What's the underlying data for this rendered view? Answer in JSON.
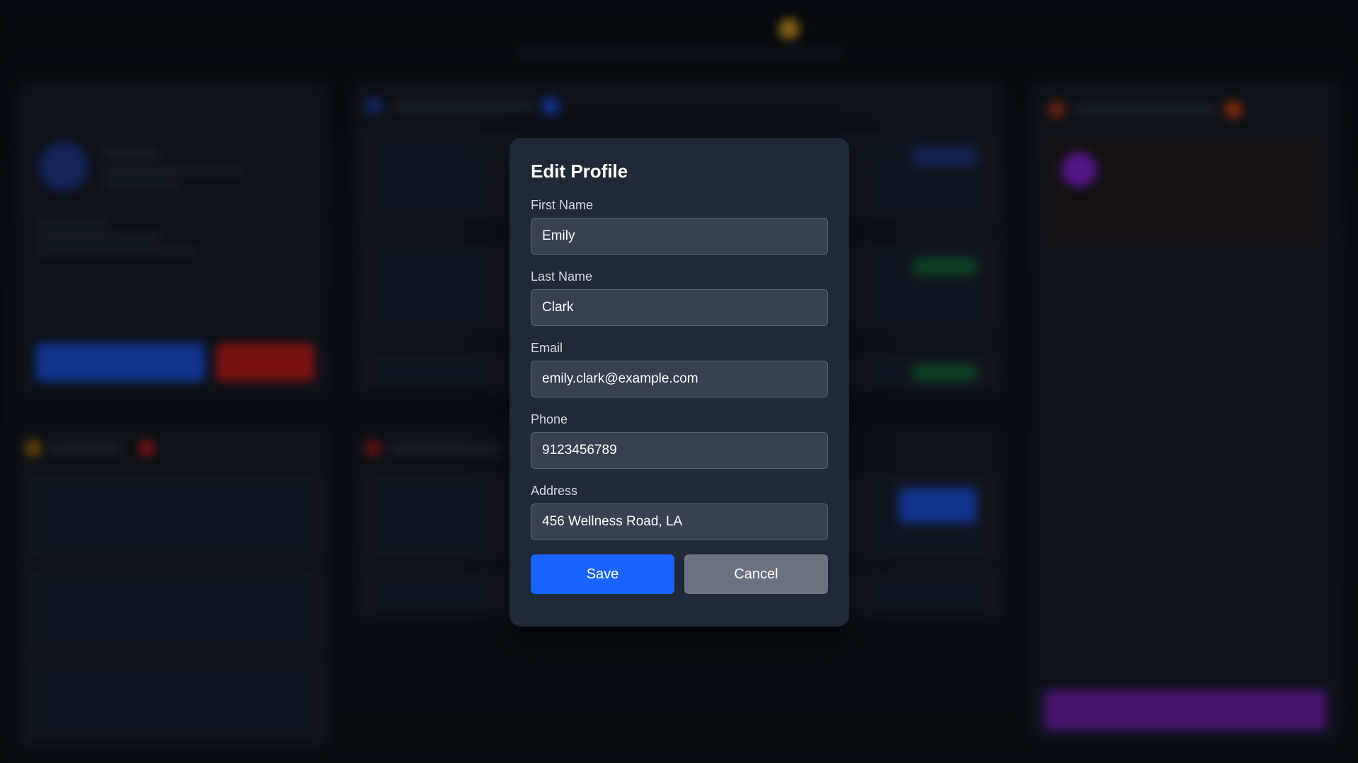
{
  "modal": {
    "title": "Edit Profile",
    "fields": [
      {
        "label": "First Name",
        "value": "Emily"
      },
      {
        "label": "Last Name",
        "value": "Clark"
      },
      {
        "label": "Email",
        "value": "emily.clark@example.com"
      },
      {
        "label": "Phone",
        "value": "9123456789"
      },
      {
        "label": "Address",
        "value": "456 Wellness Road, LA"
      }
    ],
    "save_label": "Save",
    "cancel_label": "Cancel"
  },
  "colors": {
    "modal_bg": "#1f2937",
    "input_bg": "#374151",
    "save": "#1a63ff",
    "cancel": "#6b7280",
    "page_bg": "#0b1018"
  }
}
